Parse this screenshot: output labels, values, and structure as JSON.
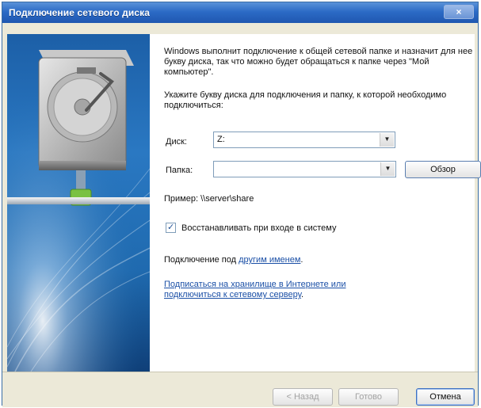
{
  "window": {
    "title": "Подключение сетевого диска",
    "close_symbol": "×"
  },
  "content": {
    "intro": "Windows выполнит подключение к общей сетевой папке и назначит для нее букву диска, так что можно будет обращаться к папке через \"Мой компьютер\".",
    "prompt": "Укажите букву диска для подключения и папку, к которой необходимо подключиться:",
    "drive_label": "Диск:",
    "drive_value": "Z:",
    "folder_label": "Папка:",
    "folder_value": "",
    "browse_label": "Обзор",
    "example": "Пример: \\\\server\\share",
    "reconnect_label": "Восстанавливать при входе в систему",
    "reconnect_checked": true,
    "connect_as_prefix": "Подключение под ",
    "connect_as_link": "другим именем",
    "connect_as_suffix": ".",
    "online_link": "Подписаться на хранилище в Интернете или подключиться к сетевому серверу",
    "online_suffix": "."
  },
  "footer": {
    "back_label": "< Назад",
    "finish_label": "Готово",
    "cancel_label": "Отмена"
  },
  "icons": {
    "close": "close-icon",
    "dropdown": "chevron-down-icon",
    "check": "checkmark-icon",
    "illustration": "network-drive-icon"
  },
  "colors": {
    "titlebar": "#2c6bc6",
    "art_background": "#1f6aaf",
    "link": "#1a4fa6",
    "network_connector": "#7ac142"
  }
}
